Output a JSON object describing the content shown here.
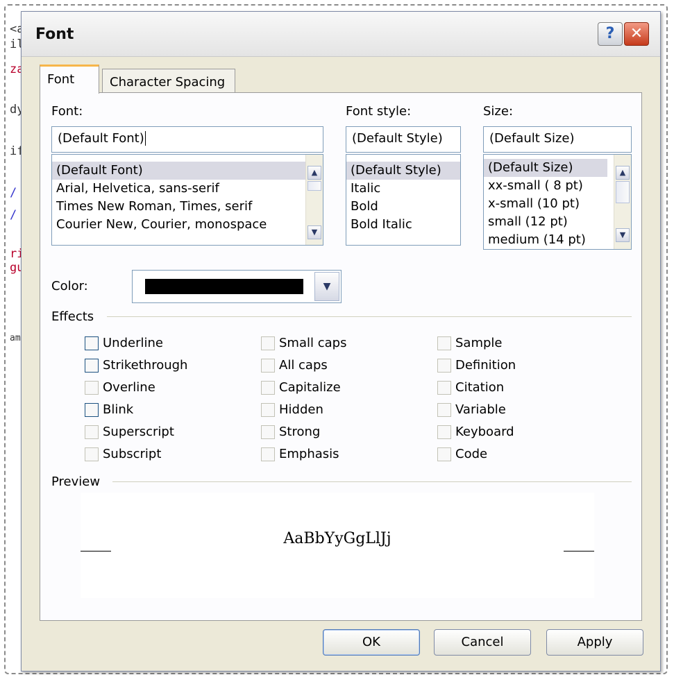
{
  "dialog": {
    "title": "Font"
  },
  "titlebar": {
    "help_glyph": "?",
    "close_glyph": "✕"
  },
  "tabs": [
    {
      "label": "Font",
      "active": true
    },
    {
      "label": "Character Spacing",
      "active": false
    }
  ],
  "font": {
    "label": "Font:",
    "value": "(Default Font)",
    "items": [
      {
        "label": "(Default Font)",
        "selected": true
      },
      {
        "label": "Arial, Helvetica, sans-serif",
        "selected": false
      },
      {
        "label": "Times New Roman, Times, serif",
        "selected": false
      },
      {
        "label": "Courier New, Courier, monospace",
        "selected": false
      }
    ]
  },
  "style": {
    "label": "Font style:",
    "value": "(Default Style)",
    "items": [
      {
        "label": "(Default Style)",
        "selected": true
      },
      {
        "label": "Italic",
        "selected": false
      },
      {
        "label": "Bold",
        "selected": false
      },
      {
        "label": "Bold Italic",
        "selected": false
      }
    ]
  },
  "size": {
    "label": "Size:",
    "value": "(Default Size)",
    "items": [
      {
        "label": "(Default Size)",
        "selected": true
      },
      {
        "label": "xx-small ( 8 pt)",
        "selected": false
      },
      {
        "label": "x-small   (10 pt)",
        "selected": false
      },
      {
        "label": "small      (12 pt)",
        "selected": false
      },
      {
        "label": "medium  (14 pt)",
        "selected": false
      }
    ]
  },
  "color": {
    "label": "Color:",
    "value_hex": "#000000"
  },
  "effects": {
    "label": "Effects",
    "columns": [
      [
        {
          "label": "Underline",
          "checked": false,
          "enabled": true
        },
        {
          "label": "Strikethrough",
          "checked": false,
          "enabled": true
        },
        {
          "label": "Overline",
          "checked": false,
          "enabled": false
        },
        {
          "label": "Blink",
          "checked": false,
          "enabled": true
        },
        {
          "label": "Superscript",
          "checked": false,
          "enabled": false
        },
        {
          "label": "Subscript",
          "checked": false,
          "enabled": false
        }
      ],
      [
        {
          "label": "Small caps",
          "checked": false,
          "enabled": false
        },
        {
          "label": "All caps",
          "checked": false,
          "enabled": false
        },
        {
          "label": "Capitalize",
          "checked": false,
          "enabled": false
        },
        {
          "label": "Hidden",
          "checked": false,
          "enabled": false
        },
        {
          "label": "Strong",
          "checked": false,
          "enabled": false
        },
        {
          "label": "Emphasis",
          "checked": false,
          "enabled": false
        }
      ],
      [
        {
          "label": "Sample",
          "checked": false,
          "enabled": false
        },
        {
          "label": "Definition",
          "checked": false,
          "enabled": false
        },
        {
          "label": "Citation",
          "checked": false,
          "enabled": false
        },
        {
          "label": "Variable",
          "checked": false,
          "enabled": false
        },
        {
          "label": "Keyboard",
          "checked": false,
          "enabled": false
        },
        {
          "label": "Code",
          "checked": false,
          "enabled": false
        }
      ]
    ]
  },
  "preview": {
    "label": "Preview",
    "sample_text": "AaBbYyGgLlJj"
  },
  "buttons": {
    "ok": "OK",
    "cancel": "Cancel",
    "apply": "Apply"
  },
  "background_code": [
    "<a",
    "il",
    "za",
    "dy",
    "if",
    "/",
    "/",
    "ri",
    "gu",
    "am"
  ],
  "colors": {
    "dialog_bg": "#ece9d8",
    "panel_bg": "#fcfcfe",
    "selection": "#d9d9e3",
    "close_red": "#c53a1b",
    "tab_accent": "#f7b64a"
  }
}
